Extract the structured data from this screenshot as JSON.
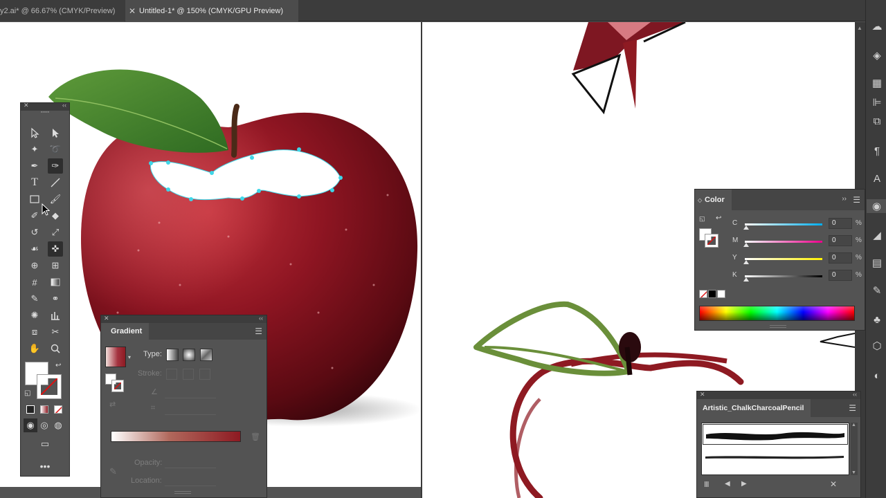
{
  "tabs": [
    {
      "label": "y2.ai* @ 66.67% (CMYK/Preview)",
      "active": false
    },
    {
      "label": "Untitled-1* @ 150% (CMYK/GPU Preview)",
      "active": true
    }
  ],
  "tab_close_glyph": "✕",
  "gradient_panel": {
    "title": "Gradient",
    "type_label": "Type:",
    "stroke_label": "Stroke:",
    "opacity_label": "Opacity:",
    "location_label": "Location:",
    "ramp_colors": [
      "#ffffff",
      "#b0685c",
      "#8e1a22"
    ]
  },
  "color_panel": {
    "title": "Color",
    "channels": [
      {
        "name": "C",
        "value": "0",
        "color": "#00aeef"
      },
      {
        "name": "M",
        "value": "0",
        "color": "#ec008c"
      },
      {
        "name": "Y",
        "value": "0",
        "color": "#fff200"
      },
      {
        "name": "K",
        "value": "0",
        "color": "#000000"
      }
    ],
    "percent": "%"
  },
  "brush_panel": {
    "title": "Artistic_ChalkCharcoalPencil"
  },
  "colors": {
    "apple_red": "#8b1420",
    "leaf_green": "#6a8f3a",
    "anchor_cyan": "#3fd6e8"
  }
}
